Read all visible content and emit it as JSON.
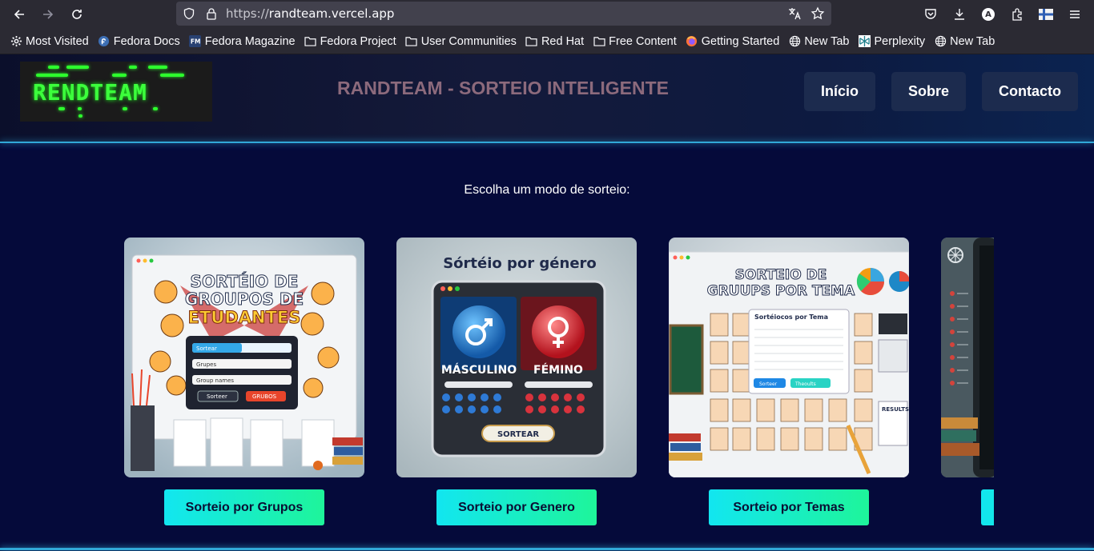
{
  "browser": {
    "url_scheme": "https://",
    "url_host": "randteam.vercel.app",
    "bookmarks": [
      {
        "label": "Most Visited",
        "icon": "gear-icon"
      },
      {
        "label": "Fedora Docs",
        "icon": "fedora-icon"
      },
      {
        "label": "Fedora Magazine",
        "icon": "fm-icon"
      },
      {
        "label": "Fedora Project",
        "icon": "folder-icon"
      },
      {
        "label": "User Communities",
        "icon": "folder-icon"
      },
      {
        "label": "Red Hat",
        "icon": "folder-icon"
      },
      {
        "label": "Free Content",
        "icon": "folder-icon"
      },
      {
        "label": "Getting Started",
        "icon": "firefox-icon"
      },
      {
        "label": "New Tab",
        "icon": "globe-icon"
      },
      {
        "label": "Perplexity",
        "icon": "perplexity-icon"
      },
      {
        "label": "New Tab",
        "icon": "globe-icon"
      }
    ]
  },
  "header": {
    "logo_text": "RENDTEAM",
    "title": "RANDTEAM - SORTEIO INTELIGENTE",
    "nav": [
      "Início",
      "Sobre",
      "Contacto"
    ]
  },
  "main": {
    "intro": "Escolha um modo de sorteio:",
    "cards": [
      {
        "image_caption": "SORTEIO DE GRUPOS DE ETUDANTES",
        "button": "Sorteio por Grupos"
      },
      {
        "image_caption": "Sórtéio por género",
        "button": "Sorteio por Genero"
      },
      {
        "image_caption": "SORTEIO DE GRUUPS POR TEMA",
        "button": "Sorteio por Temas"
      },
      {
        "image_caption": "",
        "button": ""
      }
    ],
    "card2_labels": {
      "male": "MÁSCULINO",
      "female": "FÉMINO",
      "action": "SORTEAR"
    },
    "card1_fields": [
      "Sorteear",
      "Grupes",
      "Group names",
      "Sorteer",
      "GRUBOS"
    ],
    "card3_fields": [
      "Sortéiocos por Tema",
      "Sorteer",
      "Theoults",
      "RESULTS"
    ]
  },
  "colors": {
    "accent": "#31a8d8",
    "button_start": "#12e6f0",
    "button_end": "#1ef59a",
    "page_bg": "#050a3a",
    "title": "#8c6a7c"
  }
}
